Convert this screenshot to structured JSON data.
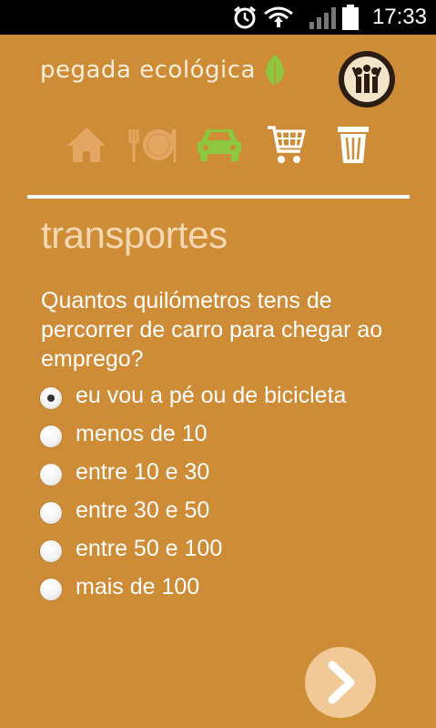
{
  "status_bar": {
    "time": "17:33",
    "icons": [
      "alarm-icon",
      "wifi-icon",
      "signal-icon",
      "battery-icon"
    ]
  },
  "app": {
    "logo_text": "pegada ecológica",
    "logo_icon": "leaf-icon",
    "avatar_icon": "people-avatar-icon"
  },
  "nav": {
    "items": [
      {
        "name": "home",
        "icon": "house-icon",
        "active": false
      },
      {
        "name": "food",
        "icon": "plate-cutlery-icon",
        "active": false
      },
      {
        "name": "transport",
        "icon": "car-icon",
        "active": true
      },
      {
        "name": "shopping",
        "icon": "cart-icon",
        "active": false
      },
      {
        "name": "waste",
        "icon": "trash-icon",
        "active": false
      }
    ],
    "active_color": "#8dc63f"
  },
  "section": {
    "title": "transportes"
  },
  "question": {
    "text": "Quantos quilómetros tens de percorrer de carro para chegar ao emprego?"
  },
  "options": [
    {
      "label": "eu vou a pé ou de bicicleta",
      "selected": true
    },
    {
      "label": "menos de 10",
      "selected": false
    },
    {
      "label": "entre 10 e 30",
      "selected": false
    },
    {
      "label": "entre 30 e 50",
      "selected": false
    },
    {
      "label": "entre 50 e 100",
      "selected": false
    },
    {
      "label": "mais de 100",
      "selected": false
    }
  ],
  "colors": {
    "background": "#cd8c35",
    "title": "#f7d7b0",
    "next_button": "#f0c996"
  }
}
